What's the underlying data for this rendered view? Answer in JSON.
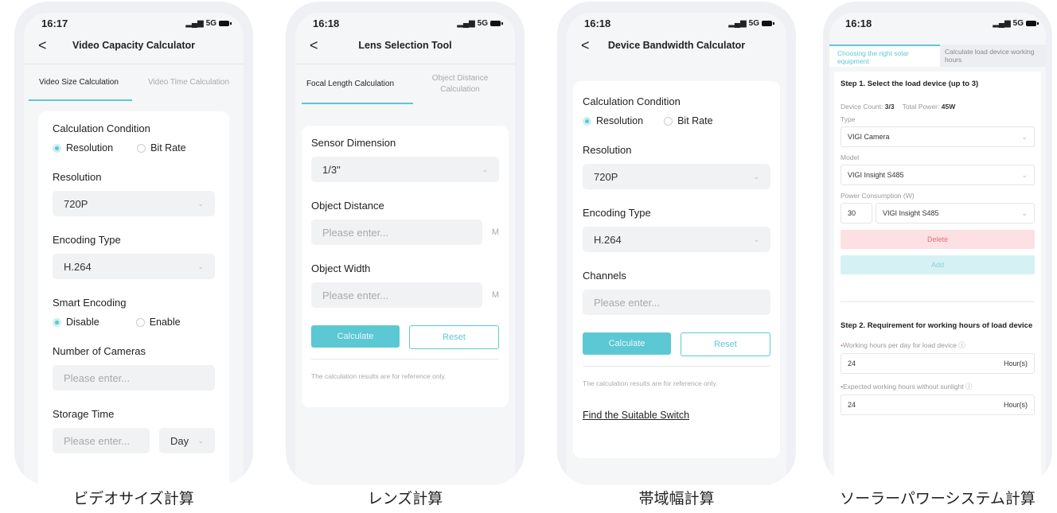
{
  "phones": [
    {
      "status": {
        "time": "16:17",
        "network": "5G"
      },
      "nav_title": "Video Capacity Calculator",
      "tabs": [
        "Video Size Calculation",
        "Video Time Calculation"
      ],
      "condition_label": "Calculation Condition",
      "radio_resolution": "Resolution",
      "radio_bitrate": "Bit Rate",
      "resolution_label": "Resolution",
      "resolution_value": "720P",
      "encoding_label": "Encoding Type",
      "encoding_value": "H.264",
      "smart_label": "Smart Encoding",
      "smart_disable": "Disable",
      "smart_enable": "Enable",
      "cameras_label": "Number of Cameras",
      "cameras_placeholder": "Please enter...",
      "storage_label": "Storage Time",
      "storage_placeholder": "Please enter...",
      "storage_unit": "Day",
      "caption": "ビデオサイズ計算"
    },
    {
      "status": {
        "time": "16:18",
        "network": "5G"
      },
      "nav_title": "Lens Selection Tool",
      "tabs": [
        "Focal Length Calculation",
        "Object Distance Calculation"
      ],
      "sensor_label": "Sensor Dimension",
      "sensor_value": "1/3\"",
      "distance_label": "Object Distance",
      "distance_placeholder": "Please enter...",
      "distance_unit": "M",
      "width_label": "Object Width",
      "width_placeholder": "Please enter...",
      "width_unit": "M",
      "calculate": "Calculate",
      "reset": "Reset",
      "note": "The calculation results are for reference only.",
      "caption": "レンズ計算"
    },
    {
      "status": {
        "time": "16:18",
        "network": "5G"
      },
      "nav_title": "Device Bandwidth Calculator",
      "condition_label": "Calculation Condition",
      "radio_resolution": "Resolution",
      "radio_bitrate": "Bit Rate",
      "resolution_label": "Resolution",
      "resolution_value": "720P",
      "encoding_label": "Encoding Type",
      "encoding_value": "H.264",
      "channels_label": "Channels",
      "channels_placeholder": "Please enter...",
      "calculate": "Calculate",
      "reset": "Reset",
      "note": "The calculation results are for reference only.",
      "link": "Find the Suitable Switch",
      "caption": "帯域幅計算"
    },
    {
      "status": {
        "time": "16:18",
        "network": "5G"
      },
      "tabs": [
        "Choosing the right solar equipment",
        "Calculate load device working hours"
      ],
      "step1": "Step 1. Select the load device (up to 3)",
      "device_count_label": "Device Count:",
      "device_count": "3/3",
      "total_power_label": "Total Power:",
      "total_power": "45W",
      "type_label": "Type",
      "type_value": "VIGI Camera",
      "model_label": "Model",
      "model_value": "VIGI Insight S485",
      "power_label": "Power Consumption (W)",
      "power_value": "30",
      "power_model": "VIGI Insight S485",
      "delete": "Delete",
      "add": "Add",
      "step2": "Step 2. Requirement for working hours of load device",
      "hours_label": "Working hours per day for load device",
      "hours_value": "24",
      "hours_unit": "Hour(s)",
      "sunless_label": "Expected working hours without sunlight",
      "sunless_value": "24",
      "sunless_unit": "Hour(s)",
      "caption": "ソーラーパワーシステム計算"
    }
  ]
}
